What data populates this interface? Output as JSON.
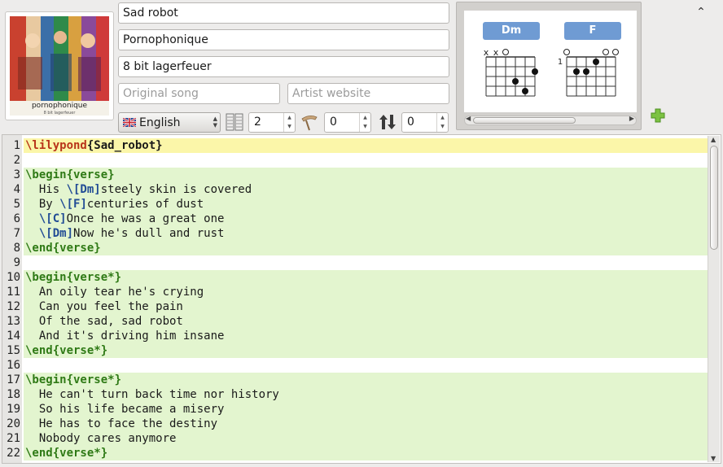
{
  "song": {
    "title": "Sad robot",
    "artist": "Pornophonique",
    "album": "8 bit lagerfeuer",
    "original_song_placeholder": "Original song",
    "artist_website_placeholder": "Artist website"
  },
  "cover": {
    "brand_text": "pornophonique",
    "sub_text": "8 bit lagerfeuer"
  },
  "toolbar": {
    "language": "English",
    "columns_value": "2",
    "capo_value": "0",
    "transpose_value": "0"
  },
  "chords": [
    {
      "name": "Dm",
      "markers": [
        "x",
        "x",
        "o",
        "",
        "",
        ""
      ],
      "fret_label": ""
    },
    {
      "name": "F",
      "markers": [
        "o",
        "",
        "",
        "",
        "o",
        "o"
      ],
      "fret_label": "1"
    }
  ],
  "editor": {
    "lines": [
      {
        "n": "1",
        "hl": "cur",
        "parts": [
          [
            "kw-red",
            "\\lilypond"
          ],
          [
            "arg-dark",
            "{Sad_robot}"
          ]
        ]
      },
      {
        "n": "2",
        "hl": "",
        "parts": []
      },
      {
        "n": "3",
        "hl": "on",
        "parts": [
          [
            "kw-green",
            "\\begin"
          ],
          [
            "kw-green",
            "{verse}"
          ]
        ]
      },
      {
        "n": "4",
        "hl": "on",
        "parts": [
          [
            "",
            "  His "
          ],
          [
            "chord",
            "\\[Dm]"
          ],
          [
            "",
            "steely skin is covered"
          ]
        ]
      },
      {
        "n": "5",
        "hl": "on",
        "parts": [
          [
            "",
            "  By "
          ],
          [
            "chord",
            "\\[F]"
          ],
          [
            "",
            "centuries of dust"
          ]
        ]
      },
      {
        "n": "6",
        "hl": "on",
        "parts": [
          [
            "",
            "  "
          ],
          [
            "chord",
            "\\[C]"
          ],
          [
            "",
            "Once he was a great one"
          ]
        ]
      },
      {
        "n": "7",
        "hl": "on",
        "parts": [
          [
            "",
            "  "
          ],
          [
            "chord",
            "\\[Dm]"
          ],
          [
            "",
            "Now he's dull and rust"
          ]
        ]
      },
      {
        "n": "8",
        "hl": "on",
        "parts": [
          [
            "kw-green",
            "\\end"
          ],
          [
            "kw-green",
            "{verse}"
          ]
        ]
      },
      {
        "n": "9",
        "hl": "",
        "parts": []
      },
      {
        "n": "10",
        "hl": "on",
        "parts": [
          [
            "kw-green",
            "\\begin"
          ],
          [
            "kw-green",
            "{verse*}"
          ]
        ]
      },
      {
        "n": "11",
        "hl": "on",
        "parts": [
          [
            "",
            "  An oily tear he's crying"
          ]
        ]
      },
      {
        "n": "12",
        "hl": "on",
        "parts": [
          [
            "",
            "  Can you feel the pain"
          ]
        ]
      },
      {
        "n": "13",
        "hl": "on",
        "parts": [
          [
            "",
            "  Of the sad, sad robot"
          ]
        ]
      },
      {
        "n": "14",
        "hl": "on",
        "parts": [
          [
            "",
            "  And it's driving him insane"
          ]
        ]
      },
      {
        "n": "15",
        "hl": "on",
        "parts": [
          [
            "kw-green",
            "\\end"
          ],
          [
            "kw-green",
            "{verse*}"
          ]
        ]
      },
      {
        "n": "16",
        "hl": "",
        "parts": []
      },
      {
        "n": "17",
        "hl": "on",
        "parts": [
          [
            "kw-green",
            "\\begin"
          ],
          [
            "kw-green",
            "{verse*}"
          ]
        ]
      },
      {
        "n": "18",
        "hl": "on",
        "parts": [
          [
            "",
            "  He can't turn back time nor history"
          ]
        ]
      },
      {
        "n": "19",
        "hl": "on",
        "parts": [
          [
            "",
            "  So his life became a misery"
          ]
        ]
      },
      {
        "n": "20",
        "hl": "on",
        "parts": [
          [
            "",
            "  He has to face the destiny"
          ]
        ]
      },
      {
        "n": "21",
        "hl": "on",
        "parts": [
          [
            "",
            "  Nobody cares anymore"
          ]
        ]
      },
      {
        "n": "22",
        "hl": "on",
        "parts": [
          [
            "kw-green",
            "\\end"
          ],
          [
            "kw-green",
            "{verse*}"
          ]
        ]
      }
    ]
  },
  "colors": {
    "chord_button": "#6f9bd3",
    "line_highlight": "#e3f5cf",
    "current_line": "#fbf6a9",
    "keyword_green": "#2f7a16",
    "keyword_red": "#b8341a",
    "chord_text": "#214c95"
  }
}
